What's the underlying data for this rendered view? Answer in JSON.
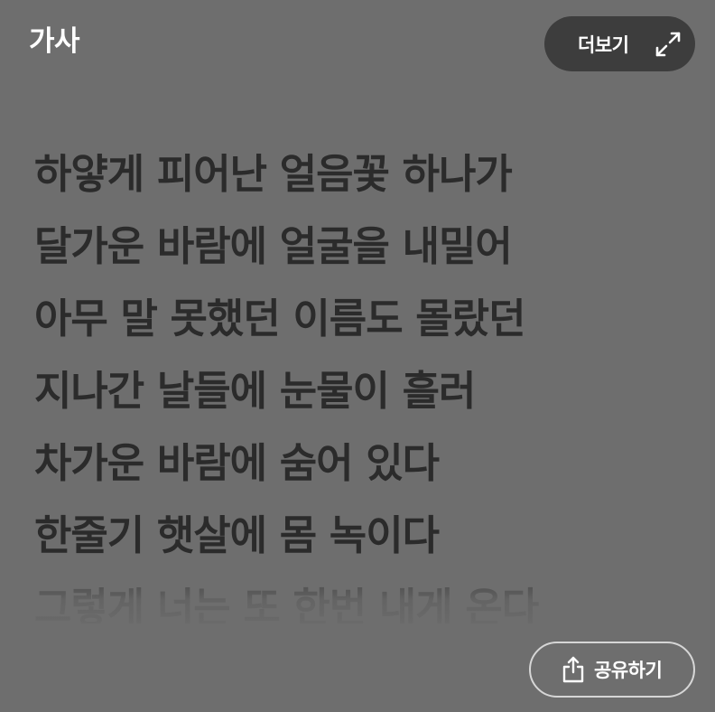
{
  "panel": {
    "title": "가사",
    "more_label": "더보기",
    "expand_icon": "expand-arrows-icon",
    "share_label": "공유하기",
    "share_icon": "share-upload-icon"
  },
  "lyrics": [
    "하얗게 피어난 얼음꽃 하나가",
    "달가운 바람에 얼굴을 내밀어",
    "아무 말 못했던 이름도 몰랐던",
    "지나간 날들에 눈물이 흘러",
    "차가운 바람에 숨어 있다",
    "한줄기 햇살에 몸 녹이다",
    "그렇게 너는 또 한번 내게 온다"
  ],
  "colors": {
    "background": "#6e6e6e",
    "lyric_text": "#2b2b2b",
    "button_dark": "#3d3d3d",
    "button_outline": "#d6d6d6",
    "white": "#ffffff"
  }
}
